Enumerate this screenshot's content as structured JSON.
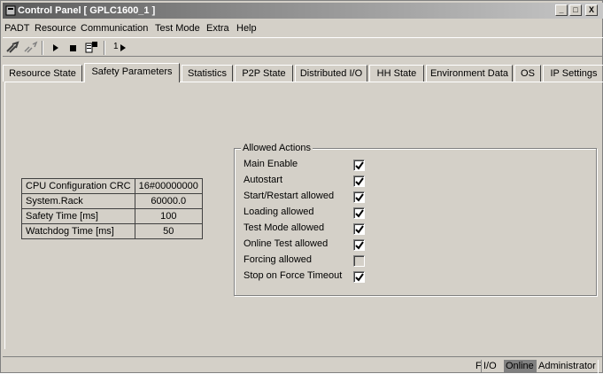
{
  "window": {
    "title": "Control Panel [ GPLC1600_1 ]",
    "controls": {
      "minimize": "_",
      "maximize": "□",
      "close": "X"
    }
  },
  "menu": [
    "PADT",
    "Resource",
    "Communication",
    "Test Mode",
    "Extra",
    "Help"
  ],
  "toolbar": {
    "icons": [
      "connect-icon",
      "disconnect-icon",
      "start-icon",
      "stop-icon",
      "download-icon",
      "step-icon"
    ],
    "step_label": "1"
  },
  "tabs": [
    "Resource State",
    "Safety Parameters",
    "Statistics",
    "P2P State",
    "Distributed I/O",
    "HH State",
    "Environment Data",
    "OS",
    "IP Settings"
  ],
  "active_tab": "Safety Parameters",
  "parameters": [
    {
      "name": "CPU Configuration CRC",
      "value": "16#00000000"
    },
    {
      "name": "System.Rack",
      "value": "60000.0"
    },
    {
      "name": "Safety Time [ms]",
      "value": "100"
    },
    {
      "name": "Watchdog Time [ms]",
      "value": "50"
    }
  ],
  "allowed_actions": {
    "legend": "Allowed Actions",
    "items": [
      {
        "label": "Main Enable",
        "checked": true
      },
      {
        "label": "Autostart",
        "checked": true
      },
      {
        "label": "Start/Restart allowed",
        "checked": true
      },
      {
        "label": "Loading allowed",
        "checked": true
      },
      {
        "label": "Test Mode allowed",
        "checked": true
      },
      {
        "label": "Online Test allowed",
        "checked": true
      },
      {
        "label": "Forcing allowed",
        "checked": false
      },
      {
        "label": "Stop on Force Timeout",
        "checked": true
      }
    ]
  },
  "status": {
    "f": "F",
    "io": "I/O",
    "mode": "Online",
    "user": "Administrator",
    "online_bg": "#808080"
  }
}
